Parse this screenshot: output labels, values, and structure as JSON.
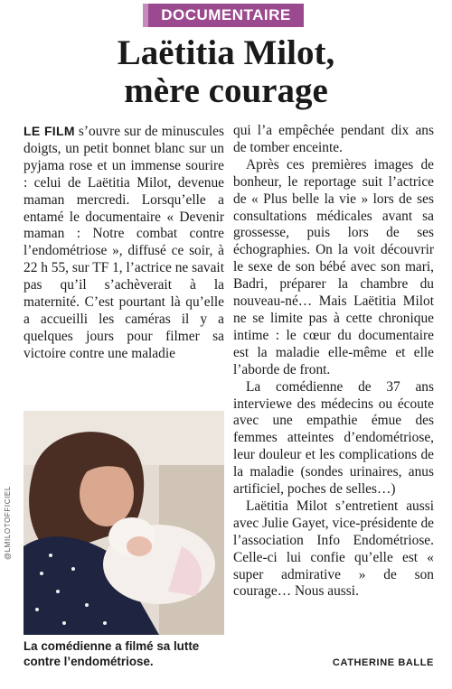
{
  "kicker": "DOCUMENTAIRE",
  "headline": {
    "line1": "Laëtitia Milot,",
    "line2": "mère courage"
  },
  "article": {
    "lead_in": "LE FILM",
    "left_paragraph": " s’ouvre sur de minuscules doigts, un petit bonnet blanc sur un pyjama rose et un immense sourire : celui de Laëtitia Milot, devenue maman mercredi. Lorsqu’elle a entamé le documentaire « Devenir maman : Notre combat contre l’endométriose », diffusé ce soir, à 22 h 55, sur TF 1, l’actrice ne savait pas qu’il s’achèverait à la maternité. C’est pourtant là qu’elle a accueilli les caméras il y a quelques jours pour filmer sa victoire contre une maladie",
    "right_continuation": "qui l’a empêchée pendant dix ans de tomber enceinte.",
    "right_paragraphs": [
      "Après ces premières images de bonheur, le reportage suit l’actrice de « Plus belle la vie » lors de ses consultations médicales avant sa grossesse, puis lors de ses échographies. On la voit découvrir le sexe de son bébé avec son mari, Badri, préparer la chambre du nouveau-né… Mais Laëtitia Milot ne se limite pas à cette chronique intime : le cœur du documentaire est la maladie elle-même et elle l’aborde de front.",
      "La comédienne de 37 ans interviewe des médecins ou écoute avec une empathie émue des femmes atteintes d’endométriose, leur douleur et les complications de la maladie (sondes urinaires, anus artificiel, poches de selles…)",
      "Laëtitia Milot s’entretient aussi avec Julie Gayet, vice-présidente de l’association Info Endométriose. Celle-ci lui confie qu’elle est « super admirative » de son courage… Nous aussi."
    ]
  },
  "photo_credit": "@LMILOTOFFICIEL",
  "caption": "La comédienne a filmé sa lutte contre l’endométriose.",
  "byline": "CATHERINE BALLE",
  "colors": {
    "kicker_bg": "#9c4a8f",
    "text": "#1a1a1a"
  }
}
